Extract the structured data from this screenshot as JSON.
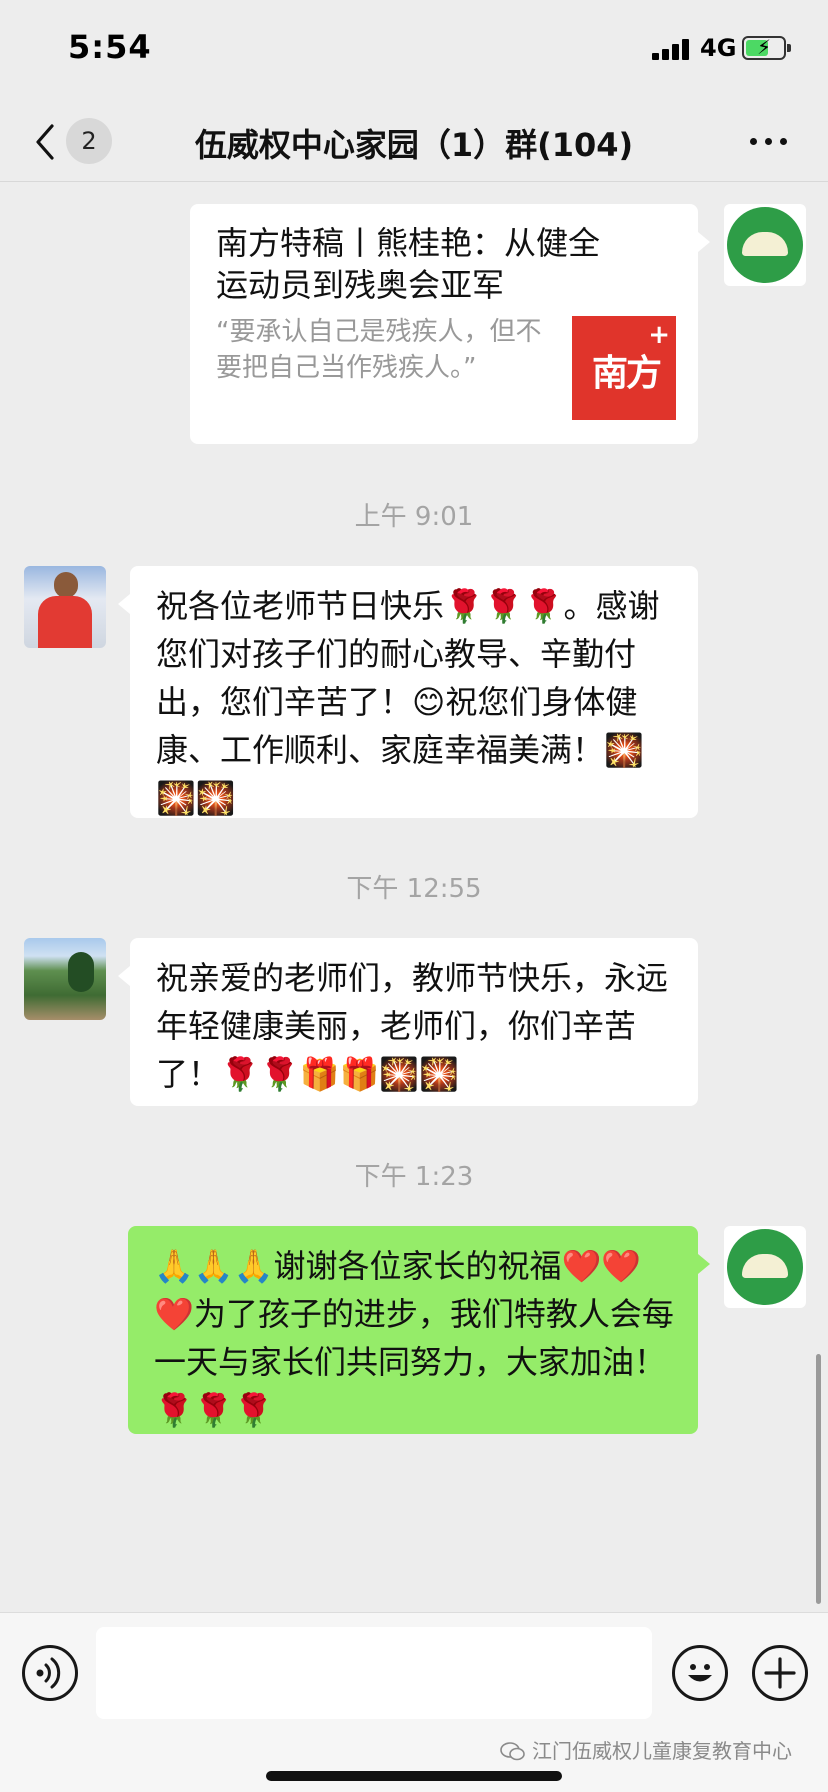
{
  "status_bar": {
    "time": "5:54",
    "network": "4G",
    "battery_charging": true,
    "battery_level": 0.6
  },
  "header": {
    "unread_count": "2",
    "title": "伍威权中心家园（1）群(104)"
  },
  "messages": [
    {
      "type": "link_card",
      "sender": "self",
      "avatar": "center-logo-avatar",
      "title": "南方特稿丨熊桂艳：从健全运动员到残奥会亚军",
      "description": "“要承认自己是残疾人，但不要把自己当作残疾人。”",
      "thumbnail_text": "南方",
      "thumbnail_plus": "+"
    },
    {
      "type": "timestamp",
      "text": "上午 9:01"
    },
    {
      "type": "text",
      "sender": "other",
      "avatar": "child-avatar",
      "text": "  祝各位老师节日快乐🌹🌹🌹。感谢您们对孩子们的耐心教导、辛勤付出，您们辛苦了！😊祝您们身体健康、工作顺利、家庭幸福美满！🎇🎇🎇"
    },
    {
      "type": "timestamp",
      "text": "下午 12:55"
    },
    {
      "type": "text",
      "sender": "other",
      "avatar": "garden-avatar",
      "text": "祝亲爱的老师们，教师节快乐，永远年轻健康美丽，老师们，你们辛苦了！🌹🌹🎁🎁🎇🎇"
    },
    {
      "type": "timestamp",
      "text": "下午 1:23"
    },
    {
      "type": "text",
      "sender": "self",
      "avatar": "center-logo-avatar",
      "text": "🙏🙏🙏谢谢各位家长的祝福❤️❤️❤️为了孩子的进步，我们特教人会每一天与家长们共同努力，大家加油！🌹🌹🌹"
    }
  ],
  "input": {
    "placeholder": ""
  },
  "watermark": "江门伍威权儿童康复教育中心",
  "colors": {
    "background": "#ededed",
    "self_bubble": "#95ec69",
    "other_bubble": "#ffffff",
    "timestamp": "#a4a4a4",
    "card_thumb": "#e0342b"
  }
}
